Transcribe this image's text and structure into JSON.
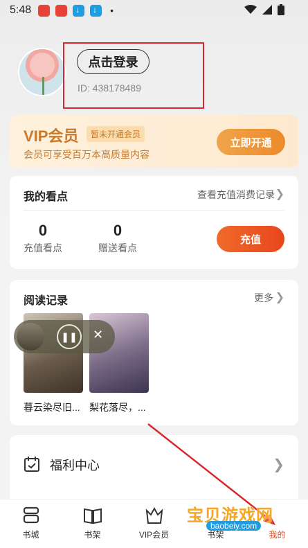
{
  "status_bar": {
    "time": "5:48",
    "dot": "•"
  },
  "profile": {
    "login_label": "点击登录",
    "user_id": "ID: 438178489"
  },
  "vip": {
    "title": "VIP会员",
    "tag": "暂未开通会员",
    "description": "会员可享受百万本高质量内容",
    "button": "立即开通"
  },
  "points": {
    "title": "我的看点",
    "link": "查看充值消费记录",
    "recharge": {
      "value": "0",
      "label": "充值看点"
    },
    "gift": {
      "value": "0",
      "label": "赠送看点"
    },
    "recharge_button": "充值"
  },
  "history": {
    "title": "阅读记录",
    "more": "更多",
    "books": [
      {
        "title": "暮云染尽旧..."
      },
      {
        "title": "梨花落尽，..."
      }
    ]
  },
  "welfare": {
    "label": "福利中心"
  },
  "tabs": [
    {
      "label": "书城",
      "icon": "bookstore-icon"
    },
    {
      "label": "书架",
      "icon": "bookshelf-icon"
    },
    {
      "label": "VIP会员",
      "icon": "vip-crown-icon"
    },
    {
      "label": "书架",
      "icon": "bookshelf-icon"
    },
    {
      "label": "我的",
      "icon": "profile-icon"
    }
  ],
  "watermark": {
    "text": "宝贝游戏网",
    "url": "baobeiy.com"
  },
  "colors": {
    "accent": "#e8461e",
    "vip_gold": "#c8792b",
    "annotation": "#d7282f"
  }
}
